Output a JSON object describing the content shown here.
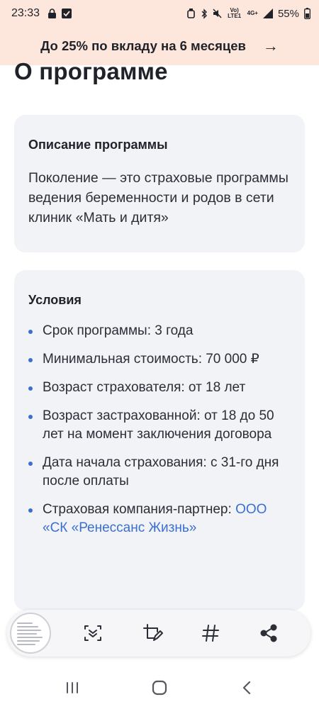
{
  "status_bar": {
    "time": "23:33",
    "signal_label": "Vo) LTE1",
    "network_label": "4G+",
    "battery": "55%"
  },
  "promo": {
    "text": "До 25% по вкладу на 6 месяцев",
    "arrow": "→"
  },
  "page": {
    "title": "О программе"
  },
  "description_card": {
    "title": "Описание программы",
    "text": "Поколение — это страховые программы ведения беременности и родов в сети клиник «Мать и дитя»"
  },
  "conditions_card": {
    "title": "Условия",
    "items": [
      {
        "text": "Срок программы: 3 года"
      },
      {
        "text": "Минимальная стоимость: 70 000 ₽"
      },
      {
        "text": "Возраст страхователя: от 18 лет"
      },
      {
        "text": "Возраст застрахованной: от 18 до 50 лет на момент заключения договора"
      },
      {
        "text": "Дата начала страхования: с 31-го дня после оплаты"
      },
      {
        "text": "Страховая компания-партнер: ",
        "link": "ООО «СК «Ренессанс Жизнь»"
      }
    ]
  },
  "toolbar": {
    "icons": [
      "screenshot-thumbnail",
      "scroll-capture-icon",
      "edit-crop-icon",
      "tag-icon",
      "share-icon"
    ]
  },
  "nav_bar": {
    "icons": [
      "recent-apps-icon",
      "home-icon",
      "back-icon"
    ]
  },
  "colors": {
    "banner_bg": "#fde6dc",
    "card_bg": "#f2f3f7",
    "accent": "#3a6fd1"
  }
}
